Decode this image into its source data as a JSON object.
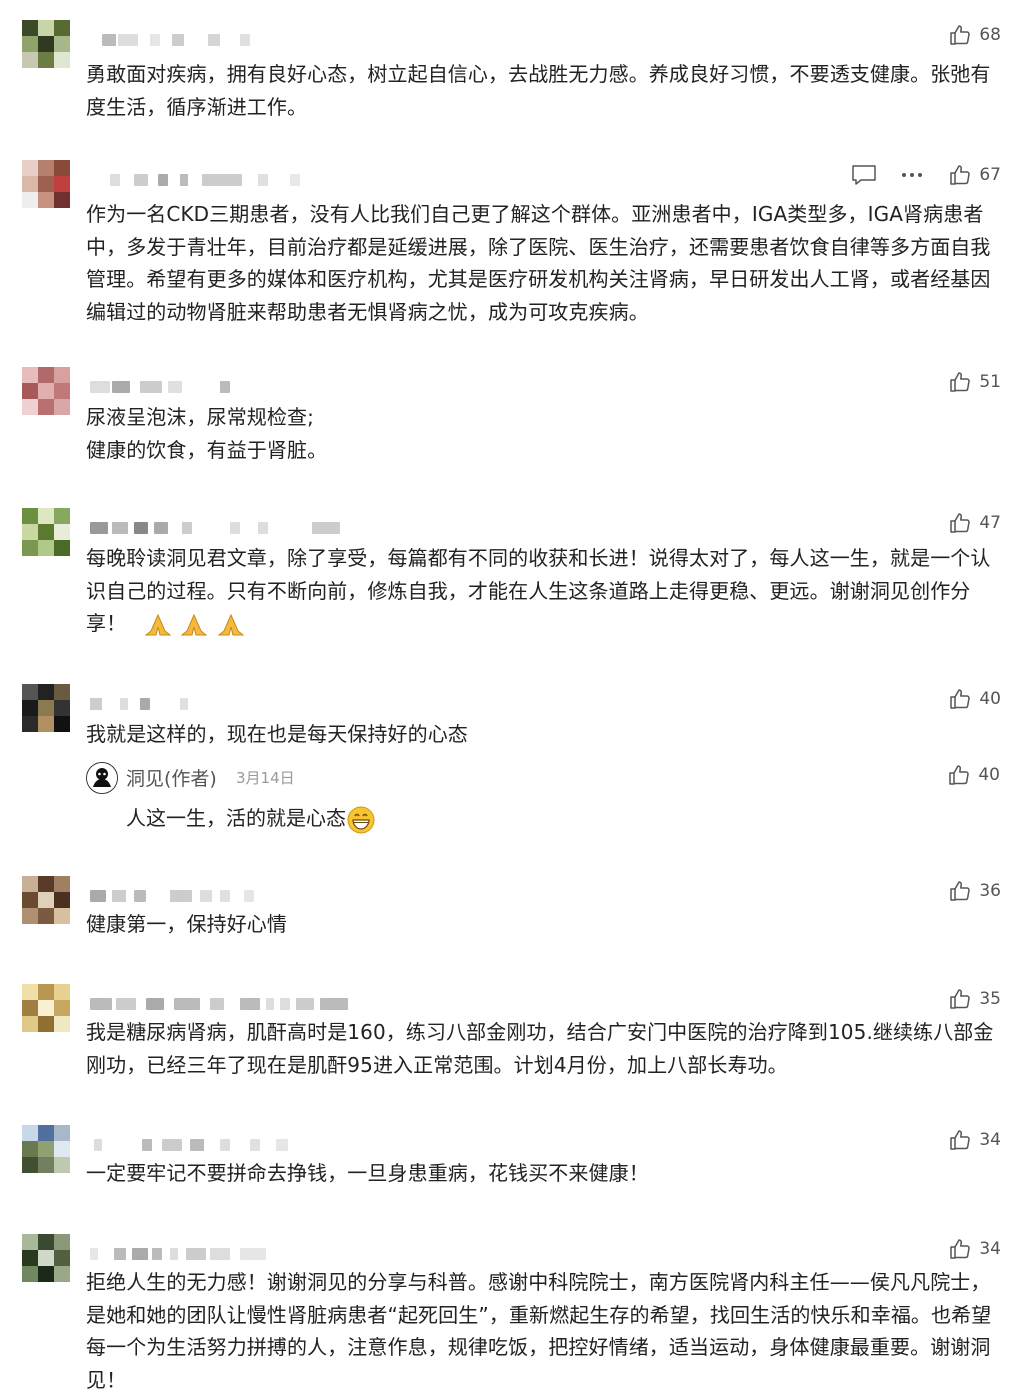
{
  "comments": [
    {
      "likes": "68",
      "text": "勇敢面对疾病，拥有良好心态，树立起自信心，去战胜无力感。养成良好习惯，不要透支健康。张弛有度生活，循序渐进工作。"
    },
    {
      "likes": "67",
      "text": "作为一名CKD三期患者，没有人比我们自己更了解这个群体。亚洲患者中，IGA类型多，IGA肾病患者中，多发于青壮年，目前治疗都是延缓进展，除了医院、医生治疗，还需要患者饮食自律等多方面自我管理。希望有更多的媒体和医疗机构，尤其是医疗研发机构关注肾病，早日研发出人工肾，或者经基因编辑过的动物肾脏来帮助患者无惧肾病之忧，成为可攻克疾病。"
    },
    {
      "likes": "51",
      "lines": [
        "尿液呈泡沫，尿常规检查;",
        "健康的饮食，有益于肾脏。"
      ]
    },
    {
      "likes": "47",
      "text": "每晚聆读洞见君文章，除了享受，每篇都有不同的收获和长进！说得太对了，每人这一生，就是一个认识自己的过程。只有不断向前，修炼自我，才能在人生这条道路上走得更稳、更远。谢谢洞见创作分享！"
    },
    {
      "likes": "40",
      "text": "我就是这样的，现在也是每天保持好的心态",
      "reply": {
        "author": "洞见(作者)",
        "date": "3月14日",
        "text": "人这一生，活的就是心态",
        "likes": "40"
      }
    },
    {
      "likes": "36",
      "text": "健康第一，保持好心情"
    },
    {
      "likes": "35",
      "text": "我是糖尿病肾病，肌酐高时是160，练习八部金刚功，结合广安门中医院的治疗降到105.继续练八部金刚功，已经三年了现在是肌酐95进入正常范围。计划4月份，加上八部长寿功。"
    },
    {
      "likes": "34",
      "text": "一定要牢记不要拼命去挣钱，一旦身患重病，花钱买不来健康！"
    },
    {
      "likes": "34",
      "text": "拒绝人生的无力感！谢谢洞见的分享与科普。感谢中科院院士，南方医院肾内科主任——侯凡凡院士，是她和她的团队让慢性肾脏病患者“起死回生”，重新燃起生存的希望，找回生活的快乐和幸福。也希望每一个为生活努力拼搏的人，注意作息，规律吃饭，把控好情绪，适当运动，身体健康最重要。谢谢洞见！"
    }
  ],
  "icons": {
    "like": "thumbs-up-icon",
    "comment": "comment-bubble-icon",
    "more": "more-dots-icon"
  },
  "colors": {
    "text": "#222222",
    "meta": "#555555",
    "date": "#999999"
  }
}
